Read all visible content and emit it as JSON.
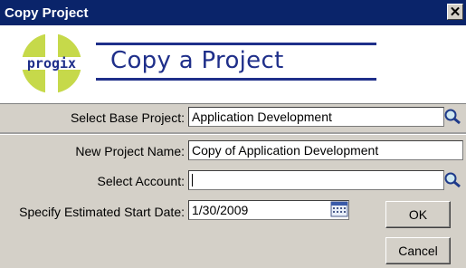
{
  "window": {
    "title": "Copy Project",
    "close_label": "✕"
  },
  "header": {
    "logo_text": "progix",
    "title": "Copy a Project"
  },
  "form": {
    "base_project": {
      "label": "Select Base Project:",
      "value": "Application Development"
    },
    "new_name": {
      "label": "New Project Name:",
      "value": "Copy of Application Development"
    },
    "account": {
      "label": "Select Account:",
      "value": ""
    },
    "start_date": {
      "label": "Specify Estimated Start Date:",
      "value": "1/30/2009"
    }
  },
  "buttons": {
    "ok": "OK",
    "cancel": "Cancel"
  },
  "colors": {
    "brand_blue": "#1f2f8a",
    "logo_green": "#c6d94a",
    "titlebar": "#0a246a"
  },
  "icons": [
    "search-icon",
    "search-icon",
    "calendar-icon"
  ]
}
